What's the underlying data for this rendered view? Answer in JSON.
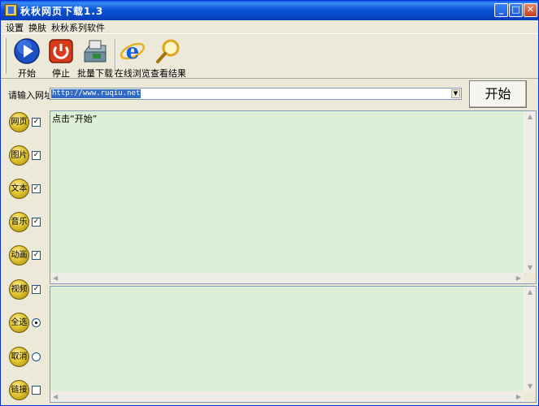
{
  "window": {
    "title": "秋秋网页下载1.3",
    "min_glyph": "_",
    "max_glyph": "□",
    "close_glyph": "✕"
  },
  "menu": [
    "设置",
    "换肤",
    "秋秋系列软件"
  ],
  "toolbar": [
    {
      "label": "开始",
      "icon": "play-icon"
    },
    {
      "label": "停止",
      "icon": "stop-icon"
    },
    {
      "label": "批量下载",
      "icon": "batch-download-icon"
    },
    {
      "label": "在线浏览",
      "icon": "ie-browser-icon"
    },
    {
      "label": "查看结果",
      "icon": "magnifier-icon"
    }
  ],
  "url": {
    "label": "请输入网址",
    "value": "http://www.ruqiu.net",
    "dropdown_glyph": "▼"
  },
  "start_button": "开始",
  "options": [
    {
      "label": "网页",
      "control": "checkbox",
      "checked": true
    },
    {
      "label": "图片",
      "control": "checkbox",
      "checked": true
    },
    {
      "label": "文本",
      "control": "checkbox",
      "checked": true
    },
    {
      "label": "音乐",
      "control": "checkbox",
      "checked": true
    },
    {
      "label": "动画",
      "control": "checkbox",
      "checked": true
    },
    {
      "label": "视频",
      "control": "checkbox",
      "checked": true
    },
    {
      "label": "全选",
      "control": "radio",
      "checked": true
    },
    {
      "label": "取消",
      "control": "radio",
      "checked": false
    },
    {
      "label": "链接",
      "control": "checkbox",
      "checked": false
    }
  ],
  "log": {
    "text": "点击“开始”"
  },
  "glyphs": {
    "check": "✓",
    "up": "▲",
    "down": "▼",
    "left": "◀",
    "right": "▶"
  },
  "colors": {
    "title_bar": "#0a5fe6",
    "pane_bg": "#dbf0d6",
    "selection": "#316ac5",
    "face": "#ece9d8"
  }
}
